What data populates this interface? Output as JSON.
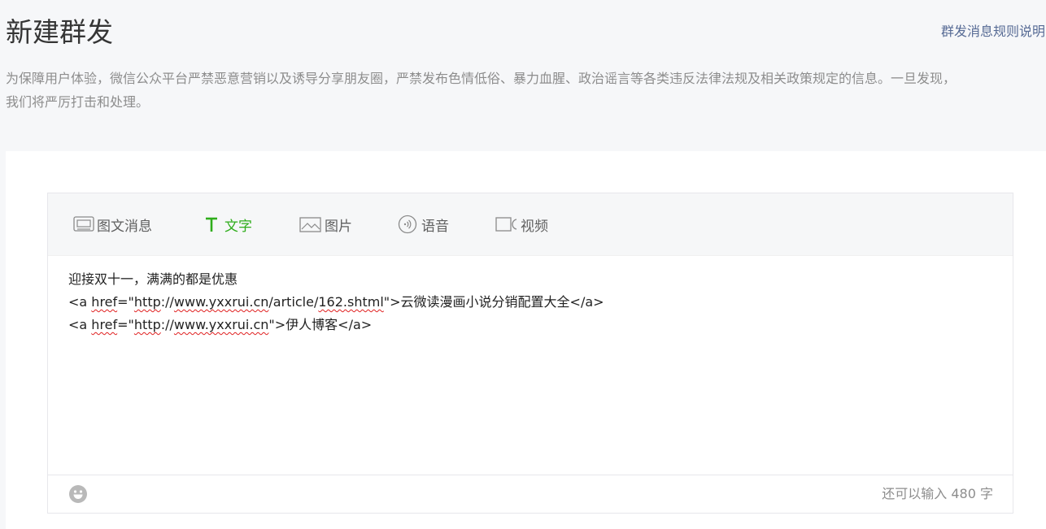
{
  "header": {
    "title": "新建群发",
    "rules_link": "群发消息规则说明"
  },
  "notice": {
    "line1": "为保障用户体验，微信公众平台严禁恶意营销以及诱导分享朋友圈，严禁发布色情低俗、暴力血腥、政治谣言等各类违反法律法规及相关政策规定的信息。一旦发现，",
    "line2": "我们将严厉打击和处理。"
  },
  "tabs": [
    {
      "label": "图文消息",
      "icon": "news-icon",
      "active": false
    },
    {
      "label": "文字",
      "icon": "text-icon",
      "active": true
    },
    {
      "label": "图片",
      "icon": "image-icon",
      "active": false
    },
    {
      "label": "语音",
      "icon": "voice-icon",
      "active": false
    },
    {
      "label": "视频",
      "icon": "video-icon",
      "active": false
    }
  ],
  "editor": {
    "line1": "迎接双十一，满满的都是优惠",
    "line2": {
      "p1": "<a ",
      "p2": "href",
      "p3": "=\"",
      "p4": "http",
      "p5": "://",
      "p6": "www.yxxrui.cn",
      "p7": "/article/",
      "p8": "162.shtml",
      "p9": "\">云微读漫画小说分销配置大全</a>"
    },
    "line3": {
      "p1": "<a ",
      "p2": "href",
      "p3": "=\"",
      "p4": "http",
      "p5": "://",
      "p6": "www.yxxrui.cn",
      "p7": "\">伊人博客</a>"
    }
  },
  "footer": {
    "emoji_icon": "smiley-icon",
    "counter": "还可以输入 480 字"
  },
  "colors": {
    "accent": "#2fad1b",
    "link": "#576b95",
    "muted": "#8d8d8d",
    "spellcheck": "#e02020"
  }
}
